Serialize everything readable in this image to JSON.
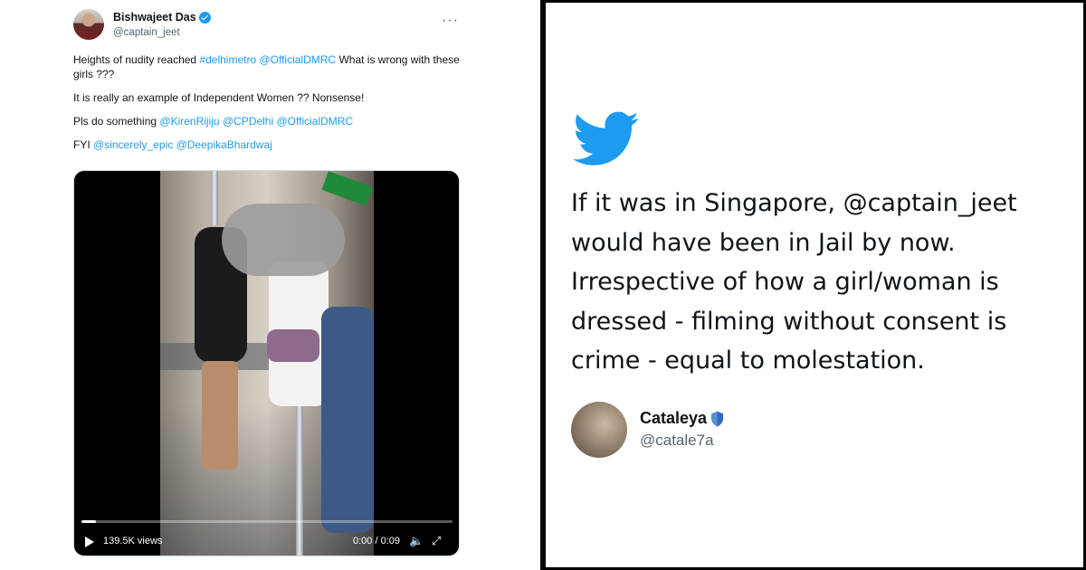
{
  "tweet": {
    "author_name": "Bishwajeet Das",
    "author_handle": "@captain_jeet",
    "line1_text": "Heights of nudity reached ",
    "line1_hashtag": "#delhimetro",
    "line1_mention": "@OfficialDMRC",
    "line1_rest": " What is wrong with these girls ???",
    "line2": "It is really an example of Independent Women ?? Nonsense!",
    "line3_text": "Pls do something ",
    "line3_m1": "@KirenRijiju",
    "line3_m2": "@CPDelhi",
    "line3_m3": "@OfficialDMRC",
    "line4_text": "FYI ",
    "line4_m1": "@sincerely_epic",
    "line4_m2": "@DeepikaBhardwaj",
    "video": {
      "views": "139.5K views",
      "duration": "0:00 / 0:09",
      "progress": 0.04
    }
  },
  "reply": {
    "text": "If it was in Singapore, @captain_jeet would have been in Jail by now. Irrespective of how a girl/woman is dressed - filming without consent is crime - equal to molestation.",
    "author_name": "Cataleya",
    "author_handle": "@catale7a"
  },
  "icons": {
    "bird": "twitter-bird-icon",
    "verified": "verified-badge-icon",
    "shield": "shield-icon",
    "more": "more-icon",
    "play": "play-icon",
    "volume": "volume-icon",
    "fullscreen": "fullscreen-icon"
  },
  "colors": {
    "twitter_blue": "#1d9bf0",
    "text": "#0f1419",
    "muted": "#536471"
  }
}
